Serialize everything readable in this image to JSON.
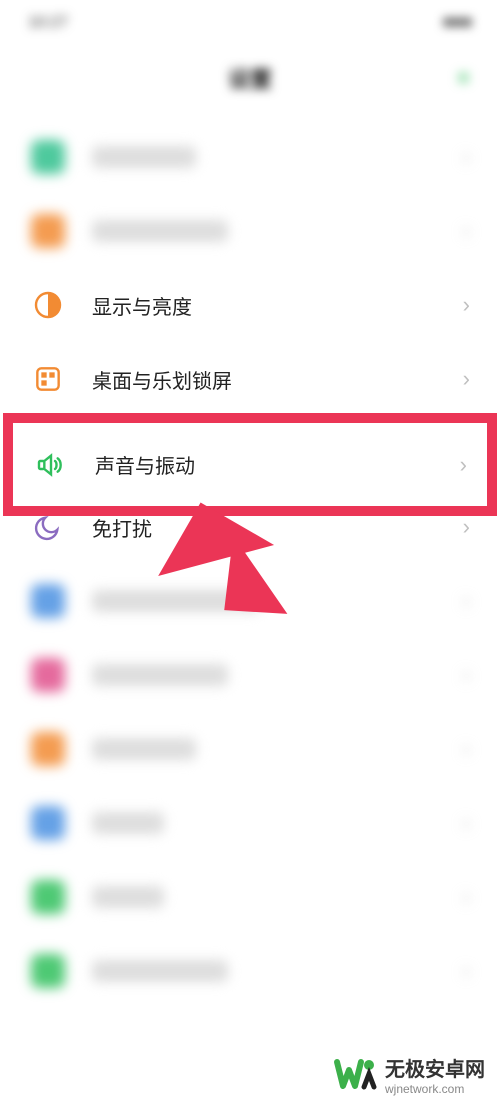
{
  "status": {
    "time": "10:27",
    "right": "■■■"
  },
  "header": {
    "title": "设置",
    "action_icon": "bars-icon"
  },
  "items": [
    {
      "label": "个性定制",
      "icon_color": "#2fbf8c",
      "icon": "sparkle"
    },
    {
      "label": "通知与状态栏",
      "icon_color": "#f28b33",
      "icon": "bell"
    },
    {
      "label": "显示与亮度",
      "icon_color": "#f28b33",
      "icon": "contrast"
    },
    {
      "label": "桌面与乐划锁屏",
      "icon_color": "#f28b33",
      "icon": "grid"
    },
    {
      "label": "声音与振动",
      "icon_color": "#2fbf5c",
      "icon": "speaker"
    },
    {
      "label": "免打扰",
      "icon_color": "#8b6cc0",
      "icon": "moon"
    },
    {
      "label": "指纹、面部与密码",
      "icon_color": "#4a90e2",
      "icon": "lock"
    },
    {
      "label": "Breeno",
      "icon_color": "#e0508c",
      "icon": "assistant"
    },
    {
      "label": "便捷辅助",
      "icon_color": "#f28b33",
      "icon": "accessibility"
    },
    {
      "label": "安全",
      "icon_color": "#4a90e2",
      "icon": "shield"
    },
    {
      "label": "电池",
      "icon_color": "#2fbf5c",
      "icon": "battery"
    },
    {
      "label": "应用使用时间",
      "icon_color": "#2fbf5c",
      "icon": "time"
    }
  ],
  "clear_items": [
    2,
    3,
    4,
    5
  ],
  "highlighted_index": 4,
  "watermark": {
    "title": "无极安卓网",
    "url": "wjnetwork.com"
  }
}
